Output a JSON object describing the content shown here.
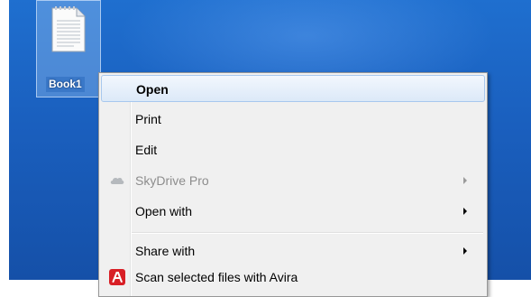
{
  "desktop": {
    "file": {
      "label": "Book1",
      "icon": "text-document-icon"
    },
    "background_color": "#1a5fbe"
  },
  "context_menu": {
    "items": [
      {
        "label": "Open",
        "bold": true,
        "highlighted": true
      },
      {
        "label": "Print"
      },
      {
        "label": "Edit"
      },
      {
        "label": "SkyDrive Pro",
        "disabled": true,
        "icon": "skydrive-cloud-icon",
        "submenu": true
      },
      {
        "label": "Open with",
        "submenu": true
      },
      {
        "label": "Share with",
        "submenu": true
      },
      {
        "label": "Scan selected files with Avira",
        "icon": "avira-icon"
      }
    ],
    "highlight_color": "#dce9f8",
    "avira_color": "#d81f26"
  }
}
